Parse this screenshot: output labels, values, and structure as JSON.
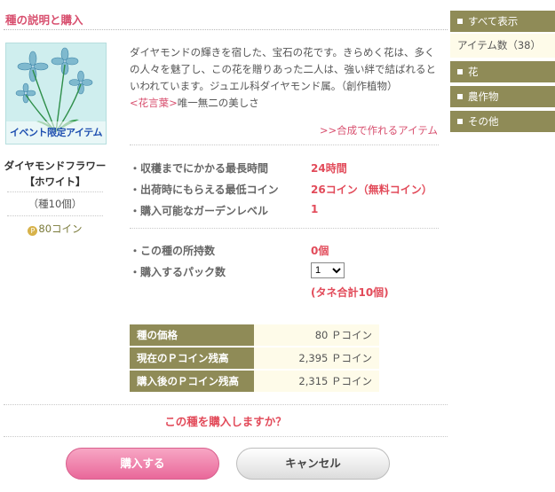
{
  "header": {
    "title": "種の説明と購入"
  },
  "item": {
    "name_line1": "ダイヤモンドフラワー",
    "name_line2": "【ホワイト】",
    "qty": "（種10個）",
    "price": "80コイン",
    "price_icon": "P",
    "image_banner": "イベント限定アイテム"
  },
  "description": {
    "text": "ダイヤモンドの輝きを宿した、宝石の花です。きらめく花は、多くの人々を魅了し、この花を贈りあった二人は、強い絆で結ばれるといわれています。ジュエル科ダイヤモンド属。（創作植物）",
    "lang_label": "<花言葉>",
    "lang_value": "唯一無二の美しさ",
    "craft_link": ">>合成で作れるアイテム"
  },
  "stats": [
    {
      "label": "・収穫までにかかる最長時間",
      "value": "24時間"
    },
    {
      "label": "・出荷時にもらえる最低コイン",
      "value": "26コイン（無料コイン）"
    },
    {
      "label": "・購入可能なガーデンレベル",
      "value": "1"
    }
  ],
  "purchase": {
    "owned_label": "・この種の所持数",
    "owned_value": "0個",
    "pack_label": "・購入するパック数",
    "pack_selected": "1",
    "pack_total": "(タネ合計10個)"
  },
  "price_table": [
    {
      "label": "種の価格",
      "value": "80 Ｐコイン"
    },
    {
      "label": "現在のＰコイン残高",
      "value": "2,395 Ｐコイン"
    },
    {
      "label": "購入後のＰコイン残高",
      "value": "2,315 Ｐコイン"
    }
  ],
  "confirm_text": "この種を購入しますか？",
  "buttons": {
    "buy": "購入する",
    "cancel": "キャンセル"
  },
  "sidebar": {
    "show_all": "すべて表示",
    "item_count": "アイテム数（38）",
    "categories": [
      "花",
      "農作物",
      "その他"
    ]
  },
  "colors": {
    "accent": "#d8506f",
    "olive": "#8f8b57",
    "value_red": "#e24b5a",
    "cream": "#fefbe9"
  }
}
